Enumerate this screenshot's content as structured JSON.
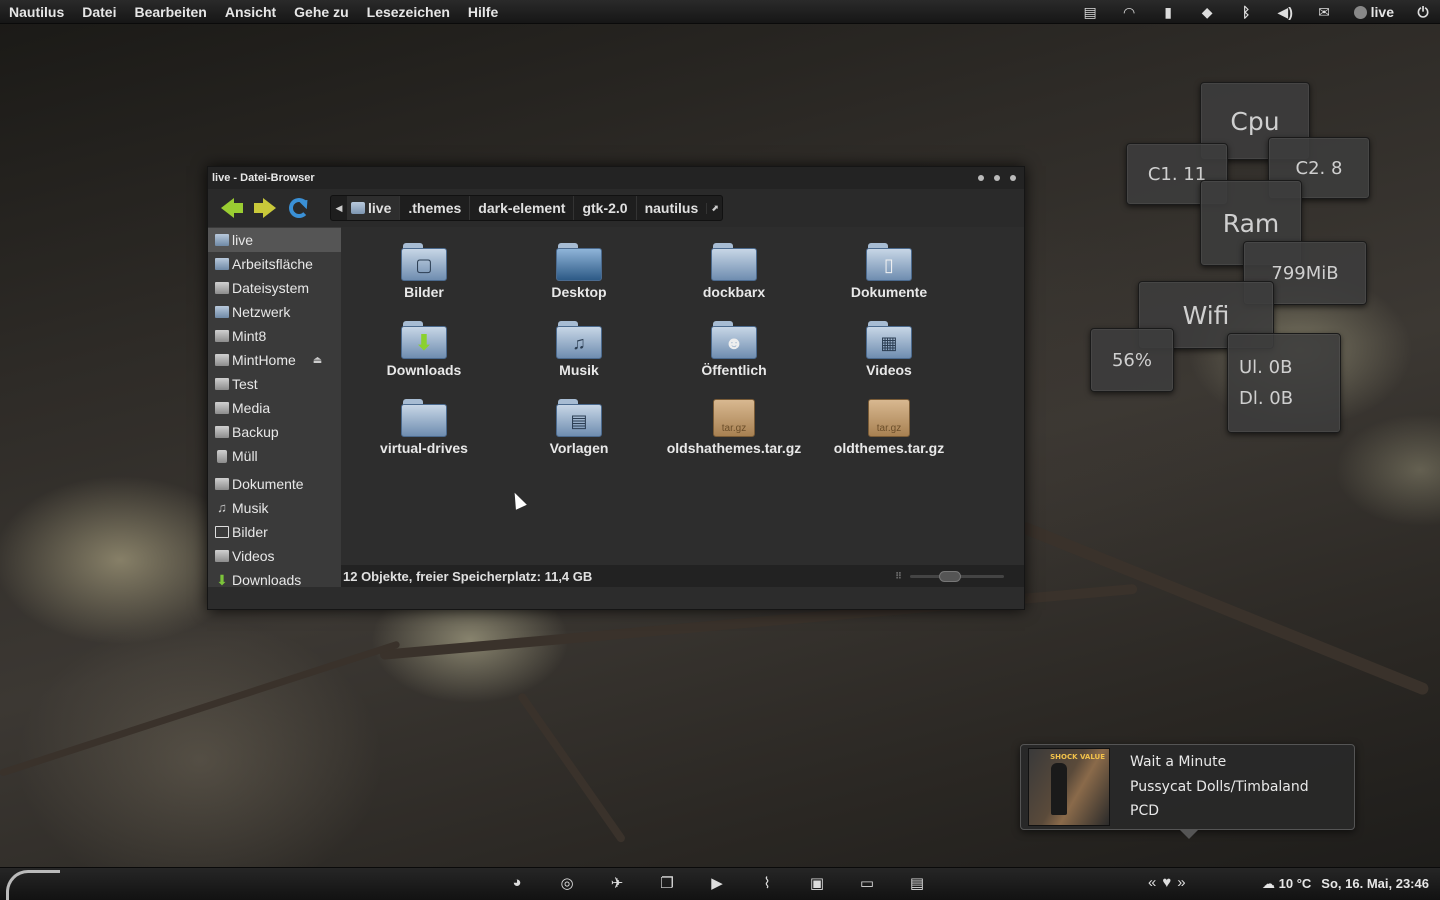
{
  "top_panel": {
    "menus": [
      "Nautilus",
      "Datei",
      "Bearbeiten",
      "Ansicht",
      "Gehe zu",
      "Lesezeichen",
      "Hilfe"
    ],
    "tray_icons": [
      "notes-icon",
      "wifi-icon",
      "battery-icon",
      "dropbox-icon",
      "bluetooth-icon",
      "volume-icon",
      "mail-icon"
    ],
    "user": "live"
  },
  "window": {
    "title": "live - Datei-Browser",
    "breadcrumbs": [
      "live",
      ".themes",
      "dark-element",
      "gtk-2.0",
      "nautilus"
    ],
    "sidebar": [
      {
        "label": "live",
        "icon": "home-icon",
        "selected": true
      },
      {
        "label": "Arbeitsfläche",
        "icon": "desktop-icon"
      },
      {
        "label": "Dateisystem",
        "icon": "drive-icon"
      },
      {
        "label": "Netzwerk",
        "icon": "network-icon"
      },
      {
        "label": "Mint8",
        "icon": "drive-icon"
      },
      {
        "label": "MintHome",
        "icon": "drive-icon",
        "eject": true
      },
      {
        "label": "Test",
        "icon": "drive-icon"
      },
      {
        "label": "Media",
        "icon": "drive-icon"
      },
      {
        "label": "Backup",
        "icon": "drive-icon"
      },
      {
        "label": "Müll",
        "icon": "trash-icon"
      },
      {
        "label": "Dokumente",
        "icon": "document-icon"
      },
      {
        "label": "Musik",
        "icon": "music-icon"
      },
      {
        "label": "Bilder",
        "icon": "pictures-icon"
      },
      {
        "label": "Videos",
        "icon": "video-icon"
      },
      {
        "label": "Downloads",
        "icon": "download-icon"
      }
    ],
    "files": [
      {
        "name": "Bilder",
        "type": "folder",
        "emblem": "▢"
      },
      {
        "name": "Desktop",
        "type": "folder",
        "emblem": ""
      },
      {
        "name": "dockbarx",
        "type": "folder",
        "emblem": ""
      },
      {
        "name": "Dokumente",
        "type": "folder",
        "emblem": "▯"
      },
      {
        "name": "Downloads",
        "type": "folder",
        "emblem": "⬇"
      },
      {
        "name": "Musik",
        "type": "folder",
        "emblem": "♫"
      },
      {
        "name": "Öffentlich",
        "type": "folder",
        "emblem": "☻"
      },
      {
        "name": "Videos",
        "type": "folder",
        "emblem": "▦"
      },
      {
        "name": "virtual-drives",
        "type": "folder",
        "emblem": ""
      },
      {
        "name": "Vorlagen",
        "type": "folder",
        "emblem": "▤"
      },
      {
        "name": "oldshathemes.tar.gz",
        "type": "archive",
        "emblem": "tar.gz"
      },
      {
        "name": "oldthemes.tar.gz",
        "type": "archive",
        "emblem": "tar.gz"
      }
    ],
    "status": "12 Objekte, freier Speicherplatz: 11,4 GB",
    "zoom_level": 0.4
  },
  "widgets": {
    "cpu_label": "Cpu",
    "c1": "C1. 11",
    "c2": "C2. 8",
    "ram_label": "Ram",
    "ram_value": "799MiB",
    "wifi_label": "Wifi",
    "wifi_value": "56%",
    "upload": "Ul. 0B",
    "download": "Dl. 0B"
  },
  "notification": {
    "title": "Wait a Minute",
    "artist": "Pussycat Dolls/Timbaland",
    "album": "PCD",
    "cover_logo": "SHOCK VALUE"
  },
  "bottom_panel": {
    "dock_icons": [
      "firefox-icon",
      "chrome-icon",
      "thunderbird-icon",
      "window-switcher-icon",
      "media-player-icon",
      "activity-monitor-icon",
      "archive-icon",
      "screen-icon",
      "file-manager-icon"
    ],
    "media_controls": [
      "previous-icon",
      "heart-icon",
      "next-icon"
    ],
    "temperature": "10 °C",
    "datetime": "So, 16. Mai, 23:46"
  },
  "colors": {
    "accent_green": "#9acd32",
    "folder_blue": "#6f8db0",
    "panel_dark": "#161616"
  }
}
